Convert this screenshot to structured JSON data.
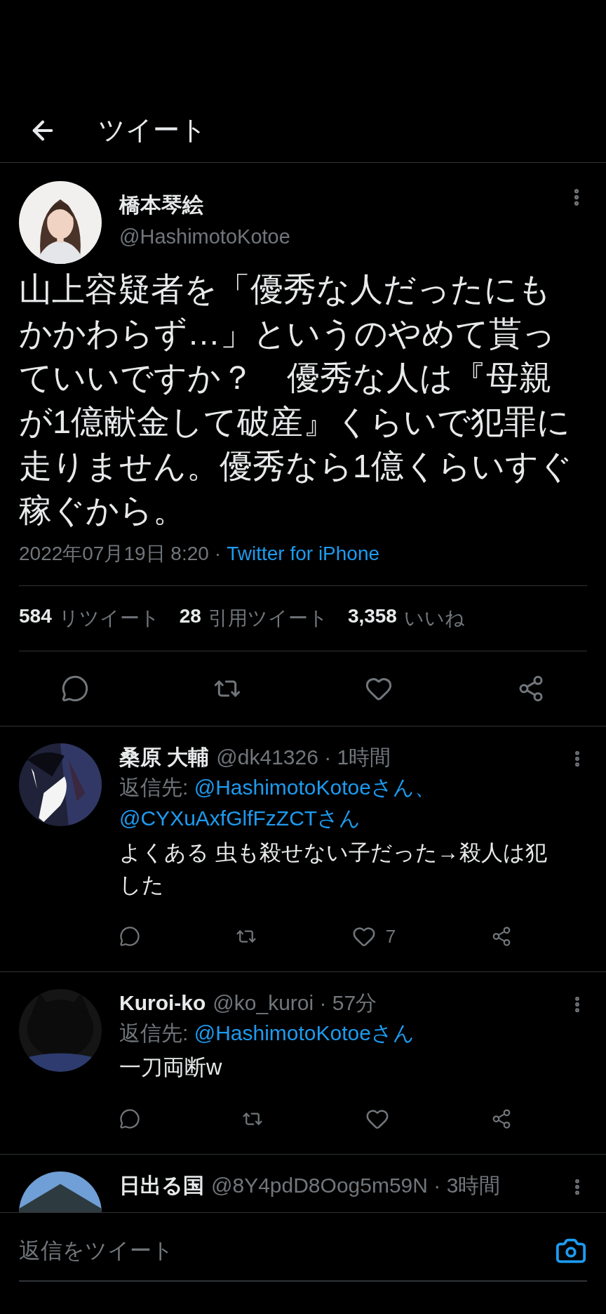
{
  "header": {
    "title": "ツイート"
  },
  "tweet": {
    "avatar": {
      "kind": "picture"
    },
    "name": "橋本琴絵",
    "handle": "@HashimotoKotoe",
    "text": "山上容疑者を「優秀な人だったにもかかわらず…」というのやめて貰っていいですか？　優秀な人は『母親が1億献金して破産』くらいで犯罪に走りません。優秀なら1億くらいすぐ稼ぐから。",
    "timestamp": "2022年07月19日 8:20",
    "separator": "·",
    "source": "Twitter for iPhone",
    "stats": [
      {
        "count": "584",
        "label": "リツイート"
      },
      {
        "count": "28",
        "label": "引用ツイート"
      },
      {
        "count": "3,358",
        "label": "いいね"
      }
    ]
  },
  "replies": [
    {
      "avatar": {
        "kind": "picture"
      },
      "name": "桑原 大輔",
      "meta": "@dk41326 · 1時間",
      "reply_to_label": "返信先:",
      "reply_to": [
        "@HashimotoKotoeさん、",
        "@CYXuAxfGlfFzZCTさん"
      ],
      "text": "よくある 虫も殺せない子だった→殺人は犯した",
      "like_count": "7"
    },
    {
      "avatar": {
        "kind": "picture"
      },
      "name": "Kuroi-ko",
      "meta": "@ko_kuroi · 57分",
      "reply_to_label": "返信先:",
      "reply_to": [
        "@HashimotoKotoeさん"
      ],
      "text": "一刀両断w"
    },
    {
      "avatar": {
        "kind": "picture"
      },
      "name": "日出る国",
      "meta": "@8Y4pdD8Oog5m59N · 3時間"
    }
  ],
  "composer": {
    "placeholder": "返信をツイート"
  }
}
